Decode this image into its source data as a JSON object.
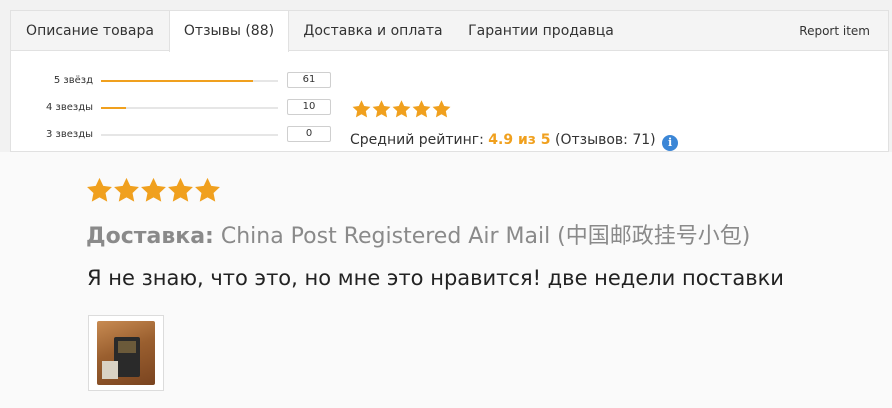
{
  "tabs": [
    {
      "label": "Описание товара",
      "active": false
    },
    {
      "label": "Отзывы (88)",
      "active": true
    },
    {
      "label": "Доставка и оплата",
      "active": false
    },
    {
      "label": "Гарантии продавца",
      "active": false
    }
  ],
  "report_label": "Report item",
  "rating_breakdown": [
    {
      "label": "5 звёзд",
      "count": "61",
      "fill_fraction": 0.86
    },
    {
      "label": "4 звезды",
      "count": "10",
      "fill_fraction": 0.14
    },
    {
      "label": "3 звезды",
      "count": "0",
      "fill_fraction": 0.0
    }
  ],
  "summary": {
    "stars": 5,
    "avg_label": "Средний рейтинг:",
    "avg_value": "4.9 из 5",
    "reviews_count_text": "(Отзывов: 71)",
    "info_icon": "i"
  },
  "review": {
    "stars": 5,
    "delivery_label": "Доставка:",
    "delivery_value": "China Post Registered Air Mail (中国邮政挂号小包)",
    "text": "Я не знаю, что это, но мне это нравится! две недели поставки"
  },
  "colors": {
    "star": "#f0a01e",
    "accent": "#f0a01e",
    "info": "#3b86d6"
  }
}
